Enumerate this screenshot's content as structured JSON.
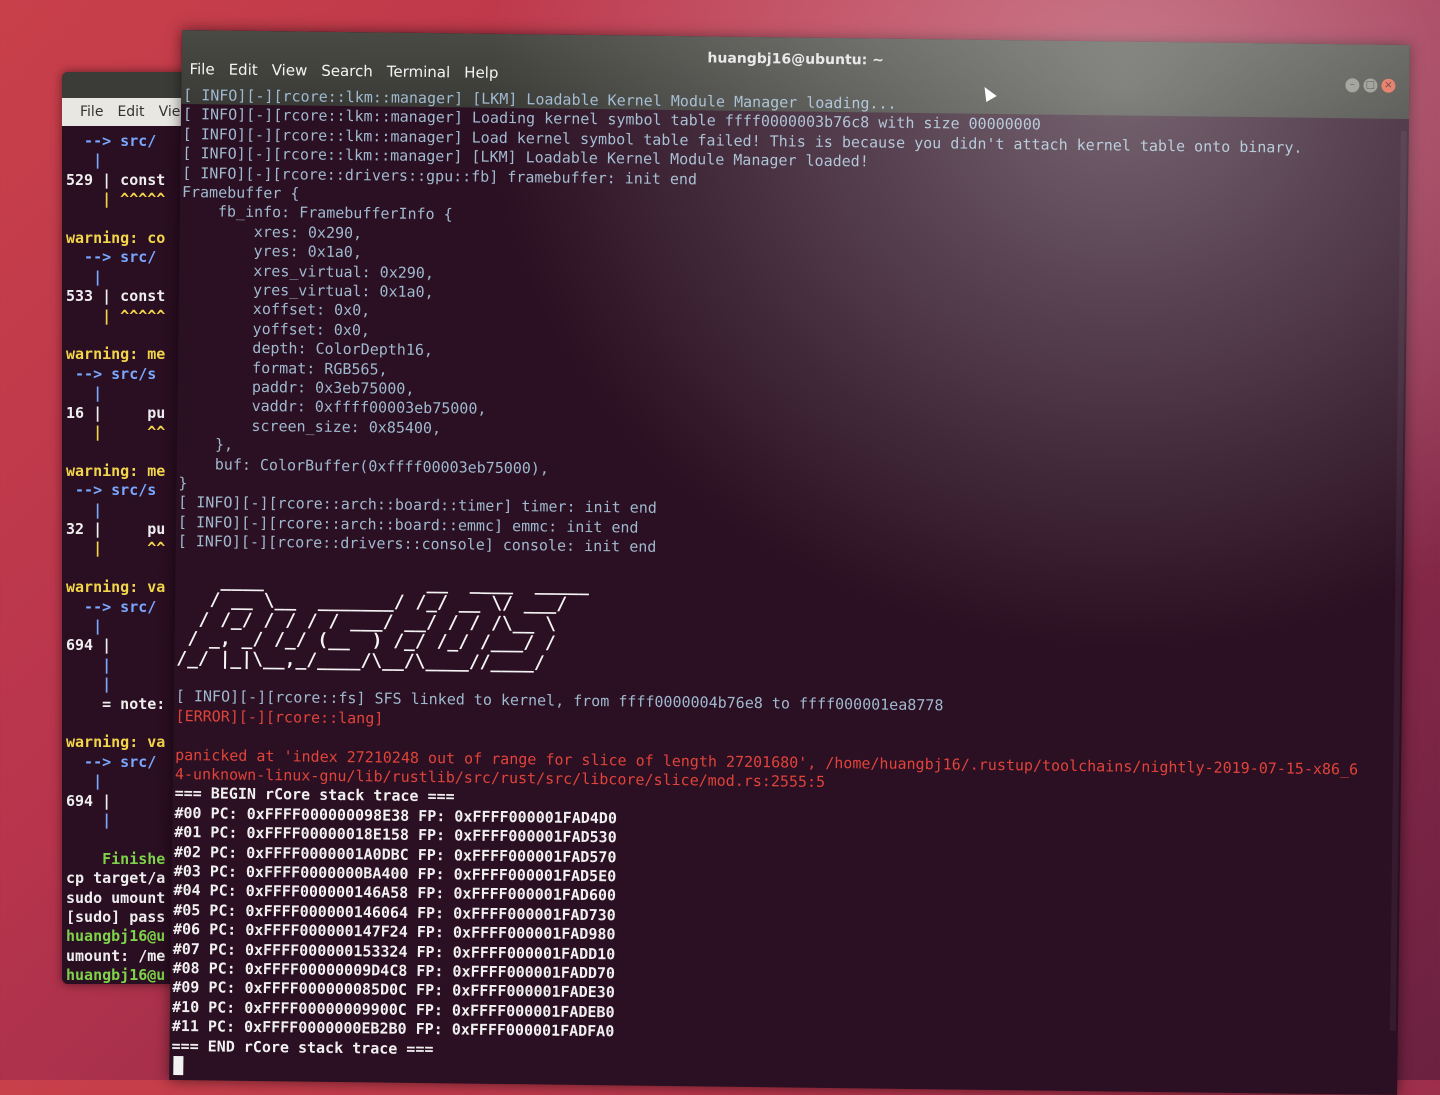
{
  "back_terminal": {
    "menu": [
      "File",
      "Edit",
      "Vie"
    ],
    "lines": [
      {
        "text": "  --> src/",
        "cls": "c-blue"
      },
      {
        "text": "   |",
        "cls": "c-blue"
      },
      {
        "text": "529 | const",
        "cls": "c-white"
      },
      {
        "text": "    | ^^^^^",
        "cls": "c-warn"
      },
      {
        "text": "",
        "cls": "c-white"
      },
      {
        "text": "warning: co",
        "cls": "c-warn"
      },
      {
        "text": "  --> src/",
        "cls": "c-blue"
      },
      {
        "text": "   |",
        "cls": "c-blue"
      },
      {
        "text": "533 | const",
        "cls": "c-white"
      },
      {
        "text": "    | ^^^^^",
        "cls": "c-warn"
      },
      {
        "text": "",
        "cls": "c-white"
      },
      {
        "text": "warning: me",
        "cls": "c-warn"
      },
      {
        "text": " --> src/s",
        "cls": "c-blue"
      },
      {
        "text": "   |",
        "cls": "c-blue"
      },
      {
        "text": "16 |     pu",
        "cls": "c-white"
      },
      {
        "text": "   |     ^^",
        "cls": "c-warn"
      },
      {
        "text": "",
        "cls": "c-white"
      },
      {
        "text": "warning: me",
        "cls": "c-warn"
      },
      {
        "text": " --> src/s",
        "cls": "c-blue"
      },
      {
        "text": "   |",
        "cls": "c-blue"
      },
      {
        "text": "32 |     pu",
        "cls": "c-white"
      },
      {
        "text": "   |     ^^",
        "cls": "c-warn"
      },
      {
        "text": "",
        "cls": "c-white"
      },
      {
        "text": "warning: va",
        "cls": "c-warn"
      },
      {
        "text": "  --> src/",
        "cls": "c-blue"
      },
      {
        "text": "   |",
        "cls": "c-blue"
      },
      {
        "text": "694 |",
        "cls": "c-white"
      },
      {
        "text": "    |",
        "cls": "c-blue"
      },
      {
        "text": "    |",
        "cls": "c-blue"
      },
      {
        "text": "    = note:",
        "cls": "c-white"
      },
      {
        "text": "",
        "cls": "c-white"
      },
      {
        "text": "warning: va",
        "cls": "c-warn"
      },
      {
        "text": "  --> src/",
        "cls": "c-blue"
      },
      {
        "text": "   |",
        "cls": "c-blue"
      },
      {
        "text": "694 |",
        "cls": "c-white"
      },
      {
        "text": "    |",
        "cls": "c-blue"
      },
      {
        "text": "",
        "cls": "c-white"
      },
      {
        "text": "    Finishe",
        "cls": "c-green"
      },
      {
        "text": "cp target/a",
        "cls": "c-white"
      },
      {
        "text": "sudo umount",
        "cls": "c-white"
      },
      {
        "text": "[sudo] pass",
        "cls": "c-white"
      },
      {
        "text": "huangbj16@u",
        "cls": "c-green"
      },
      {
        "text": "umount: /me",
        "cls": "c-white"
      },
      {
        "text": "huangbj16@u",
        "cls": "c-green"
      }
    ]
  },
  "main_terminal": {
    "title": "huangbj16@ubuntu: ~",
    "menu": [
      "File",
      "Edit",
      "View",
      "Search",
      "Terminal",
      "Help"
    ],
    "window_buttons": [
      "–",
      "□",
      "×"
    ],
    "lines": [
      {
        "text": "[ INFO][-][rcore::lkm::manager] [LKM] Loadable Kernel Module Manager loading...",
        "cls": "info"
      },
      {
        "text": "[ INFO][-][rcore::lkm::manager] Loading kernel symbol table ffff0000003b76c8 with size 00000000",
        "cls": "info"
      },
      {
        "text": "[ INFO][-][rcore::lkm::manager] Load kernel symbol table failed! This is because you didn't attach kernel table onto binary.",
        "cls": "info"
      },
      {
        "text": "[ INFO][-][rcore::lkm::manager] [LKM] Loadable Kernel Module Manager loaded!",
        "cls": "info"
      },
      {
        "text": "[ INFO][-][rcore::drivers::gpu::fb] framebuffer: init end",
        "cls": "info"
      },
      {
        "text": "Framebuffer {",
        "cls": "info"
      },
      {
        "text": "    fb_info: FramebufferInfo {",
        "cls": "info"
      },
      {
        "text": "        xres: 0x290,",
        "cls": "info"
      },
      {
        "text": "        yres: 0x1a0,",
        "cls": "info"
      },
      {
        "text": "        xres_virtual: 0x290,",
        "cls": "info"
      },
      {
        "text": "        yres_virtual: 0x1a0,",
        "cls": "info"
      },
      {
        "text": "        xoffset: 0x0,",
        "cls": "info"
      },
      {
        "text": "        yoffset: 0x0,",
        "cls": "info"
      },
      {
        "text": "        depth: ColorDepth16,",
        "cls": "info"
      },
      {
        "text": "        format: RGB565,",
        "cls": "info"
      },
      {
        "text": "        paddr: 0x3eb75000,",
        "cls": "info"
      },
      {
        "text": "        vaddr: 0xffff00003eb75000,",
        "cls": "info"
      },
      {
        "text": "        screen_size: 0x85400,",
        "cls": "info"
      },
      {
        "text": "    },",
        "cls": "info"
      },
      {
        "text": "    buf: ColorBuffer(0xffff00003eb75000),",
        "cls": "info"
      },
      {
        "text": "}",
        "cls": "info"
      },
      {
        "text": "[ INFO][-][rcore::arch::board::timer] timer: init end",
        "cls": "info"
      },
      {
        "text": "[ INFO][-][rcore::arch::board::emmc] emmc: init end",
        "cls": "info"
      },
      {
        "text": "[ INFO][-][rcore::drivers::console] console: init end",
        "cls": "info"
      },
      {
        "text": "",
        "cls": "info"
      },
      {
        "text": "    ____               __  ____  _____",
        "cls": "ascii"
      },
      {
        "text": "   / __ \\__  _______/ /_/ __ \\/ ___/",
        "cls": "ascii"
      },
      {
        "text": "  / /_/ / / / / ___/ __/ / / /\\__ \\",
        "cls": "ascii"
      },
      {
        "text": " / _, _/ /_/ (__  ) /_/ /_/ /___/ /",
        "cls": "ascii"
      },
      {
        "text": "/_/ |_|\\__,_/____/\\__/\\____//____/",
        "cls": "ascii"
      },
      {
        "text": "",
        "cls": "info"
      },
      {
        "text": "[ INFO][-][rcore::fs] SFS linked to kernel, from ffff0000004b76e8 to ffff000001ea8778",
        "cls": "info"
      },
      {
        "text": "[ERROR][-][rcore::lang]",
        "cls": "err"
      },
      {
        "text": "",
        "cls": "info"
      },
      {
        "text": "panicked at 'index 27210248 out of range for slice of length 27201680', /home/huangbj16/.rustup/toolchains/nightly-2019-07-15-x86_6",
        "cls": "panic"
      },
      {
        "text": "4-unknown-linux-gnu/lib/rustlib/src/rust/src/libcore/slice/mod.rs:2555:5",
        "cls": "panic"
      },
      {
        "text": "=== BEGIN rCore stack trace ===",
        "cls": "trace"
      },
      {
        "text": "#00 PC: 0xFFFF000000098E38 FP: 0xFFFF000001FAD4D0",
        "cls": "trace"
      },
      {
        "text": "#01 PC: 0xFFFF00000018E158 FP: 0xFFFF000001FAD530",
        "cls": "trace"
      },
      {
        "text": "#02 PC: 0xFFFF0000001A0DBC FP: 0xFFFF000001FAD570",
        "cls": "trace"
      },
      {
        "text": "#03 PC: 0xFFFF0000000BA400 FP: 0xFFFF000001FAD5E0",
        "cls": "trace"
      },
      {
        "text": "#04 PC: 0xFFFF000000146A58 FP: 0xFFFF000001FAD600",
        "cls": "trace"
      },
      {
        "text": "#05 PC: 0xFFFF000000146064 FP: 0xFFFF000001FAD730",
        "cls": "trace"
      },
      {
        "text": "#06 PC: 0xFFFF000000147F24 FP: 0xFFFF000001FAD980",
        "cls": "trace"
      },
      {
        "text": "#07 PC: 0xFFFF000000153324 FP: 0xFFFF000001FADD10",
        "cls": "trace"
      },
      {
        "text": "#08 PC: 0xFFFF00000009D4C8 FP: 0xFFFF000001FADD70",
        "cls": "trace"
      },
      {
        "text": "#09 PC: 0xFFFF000000085D0C FP: 0xFFFF000001FADE30",
        "cls": "trace"
      },
      {
        "text": "#10 PC: 0xFFFF00000009900C FP: 0xFFFF000001FADEB0",
        "cls": "trace"
      },
      {
        "text": "#11 PC: 0xFFFF0000000EB2B0 FP: 0xFFFF000001FADFA0",
        "cls": "trace"
      },
      {
        "text": "=== END rCore stack trace ===",
        "cls": "trace"
      }
    ]
  }
}
